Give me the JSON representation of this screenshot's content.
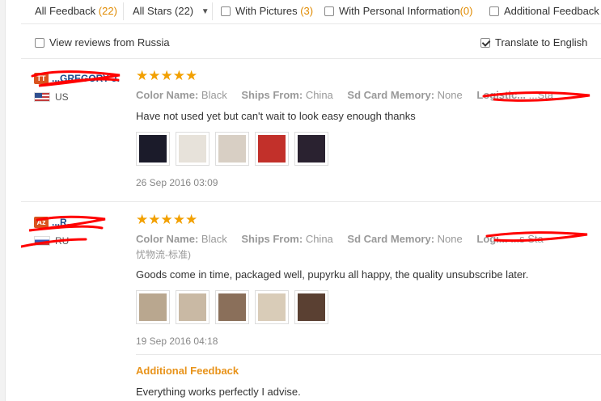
{
  "filters": {
    "all_feedback": "All Feedback",
    "all_feedback_count": "(22)",
    "all_stars": "All Stars (22)",
    "with_pictures": "With Pictures",
    "with_pictures_count": "(3)",
    "with_personal_info": "With Personal Information",
    "with_personal_info_count": "(0)",
    "additional_feedback": "Additional Feedback"
  },
  "options": {
    "view_russia": "View reviews from Russia",
    "view_russia_checked": false,
    "translate": "Translate to English",
    "translate_checked": true
  },
  "reviews": [
    {
      "badge": "TT",
      "name": "...GREGORY J.",
      "country": "US",
      "stars": "★★★★★",
      "attr_color_label": "Color Name:",
      "attr_color_value": "Black",
      "attr_ships_label": "Ships From:",
      "attr_ships_value": "China",
      "attr_sd_label": "Sd Card Memory:",
      "attr_sd_value": "None",
      "attr_logistic_label": "Logistic...",
      "attr_logistic_value": "...Sta",
      "text": "Have not used yet but can't wait to look easy enough thanks",
      "date": "26 Sep 2016 03:09",
      "thumb_colors": [
        "#1b1b2a",
        "#e7e2da",
        "#d8cfc4",
        "#c2302a",
        "#2a2230"
      ]
    },
    {
      "badge": "Az",
      "name": "...R.",
      "country": "RU",
      "stars": "★★★★★",
      "attr_color_label": "Color Name:",
      "attr_color_value": "Black",
      "attr_ships_label": "Ships From:",
      "attr_ships_value": "China",
      "attr_sd_label": "Sd Card Memory:",
      "attr_sd_value": "None",
      "attr_logistic_label": "Logi...",
      "attr_logistic_value": "...s Sta",
      "extra_line": "忧物流-标准)",
      "text": "Goods come in time, packaged well, pupyrku all happy, the quality unsubscribe later.",
      "date": "19 Sep 2016 04:18",
      "thumb_colors": [
        "#b9a78f",
        "#c9b9a4",
        "#8a6f5a",
        "#d9ccb8",
        "#5a4032"
      ],
      "additional_title": "Additional Feedback",
      "additional_text": "Everything works perfectly I advise."
    }
  ],
  "redaction_color": "#ff0000"
}
